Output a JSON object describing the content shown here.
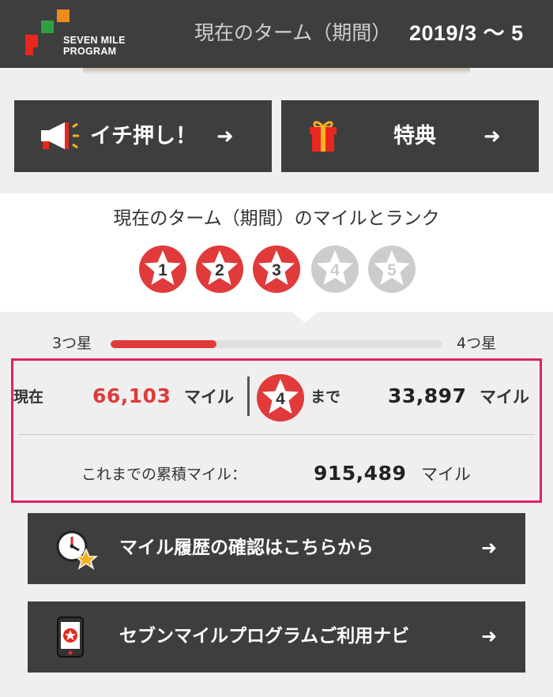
{
  "header": {
    "logo_line1": "SEVEN MILE",
    "logo_line2": "PROGRAM",
    "term_label": "現在のターム（期間）",
    "term_dates": "2019/3 ～ 5"
  },
  "top_buttons": {
    "recommend_label": "イチ押し！",
    "recommend_icon": "megaphone-icon",
    "benefits_label": "特典",
    "benefits_icon": "gift-icon",
    "arrow": "➜"
  },
  "rank": {
    "title": "現在のターム（期間）のマイルとランク",
    "stars": [
      {
        "number": "1",
        "achieved": true
      },
      {
        "number": "2",
        "achieved": true
      },
      {
        "number": "3",
        "achieved": true
      },
      {
        "number": "4",
        "achieved": false
      },
      {
        "number": "5",
        "achieved": false
      }
    ],
    "colors": {
      "achieved": "#e03a3a",
      "pending": "#cccccc"
    }
  },
  "progress": {
    "from_label": "3つ星",
    "to_label": "4つ星",
    "percent": 32
  },
  "miles": {
    "current_label": "現在",
    "current_value": "66,103",
    "unit": "マイル",
    "next_rank": "4",
    "until_label": "まで",
    "remaining_value": "33,897",
    "total_label": "これまでの累積マイル：",
    "total_value": "915,489"
  },
  "links": [
    {
      "label": "マイル履歴の確認はこちらから",
      "icon": "clock-star-icon"
    },
    {
      "label": "セブンマイルプログラムご利用ナビ",
      "icon": "smartphone-icon"
    }
  ],
  "link_arrow": "➜",
  "accent_colors": {
    "red": "#e03a3a",
    "highlight_border": "#e01f6a",
    "dark": "#3e3e3e"
  }
}
